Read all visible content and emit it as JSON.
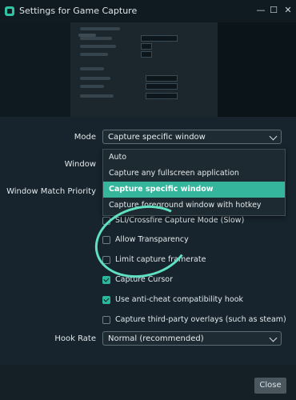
{
  "window": {
    "title": "Settings for Game Capture",
    "minimize": "—",
    "maximize": "☐",
    "close": "✕"
  },
  "form": {
    "mode_label": "Mode",
    "mode_value": "Capture specific window",
    "window_label": "Window",
    "match_priority_label": "Window Match Priority",
    "sli_label": "SLI/Crossfire Capture Mode (Slow)",
    "allow_transparency_label": "Allow Transparency",
    "limit_framerate_label": "Limit capture framerate",
    "capture_cursor_label": "Capture Cursor",
    "anticheat_label": "Use anti-cheat compatibility hook",
    "third_party_label": "Capture third-party overlays (such as steam)",
    "hook_rate_label": "Hook Rate",
    "hook_rate_value": "Normal (recommended)"
  },
  "dropdown": {
    "options": [
      "Auto",
      "Capture any fullscreen application",
      "Capture specific window",
      "Capture foreground window with hotkey"
    ],
    "selected": "Capture specific window"
  },
  "checkboxes": {
    "sli": false,
    "allow_transparency": false,
    "limit_framerate": false,
    "capture_cursor": true,
    "anticheat": true,
    "third_party": false
  },
  "footer": {
    "close_label": "Close"
  },
  "colors": {
    "accent": "#34b59c",
    "background": "#17242d",
    "annotation": "#5fe0c0"
  }
}
